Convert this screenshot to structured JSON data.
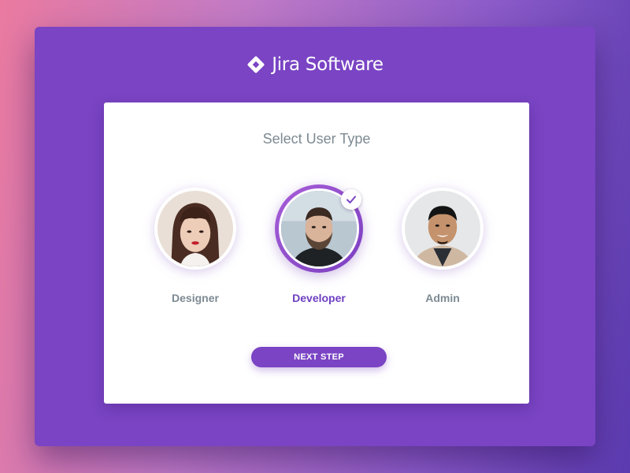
{
  "brand": {
    "name": "Jira Software",
    "logo_icon": "jira-diamond-icon"
  },
  "card": {
    "title": "Select User Type"
  },
  "user_types": [
    {
      "label": "Designer",
      "selected": false,
      "avatar": "female-portrait"
    },
    {
      "label": "Developer",
      "selected": true,
      "avatar": "bearded-male-portrait",
      "badge_icon": "checkmark-icon"
    },
    {
      "label": "Admin",
      "selected": false,
      "avatar": "smiling-male-portrait"
    }
  ],
  "actions": {
    "next_label": "NEXT STEP"
  },
  "colors": {
    "accent": "#7a44c4",
    "selected_label": "#6e3fc0",
    "muted_text": "#7d8a92",
    "card_background": "#ffffff"
  }
}
